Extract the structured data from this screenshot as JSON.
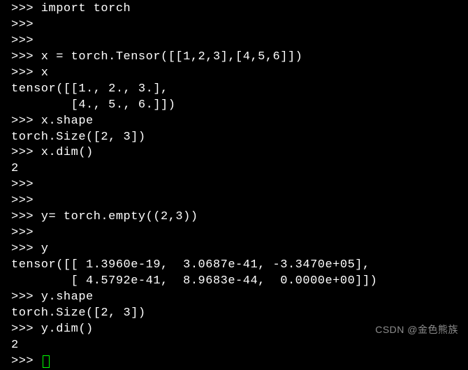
{
  "terminal": {
    "prompt": ">>> ",
    "lines": [
      {
        "text": ">>> import torch"
      },
      {
        "text": ">>>"
      },
      {
        "text": ">>>"
      },
      {
        "text": ">>> x = torch.Tensor([[1,2,3],[4,5,6]])"
      },
      {
        "text": ">>> x"
      },
      {
        "text": "tensor([[1., 2., 3.],"
      },
      {
        "text": "        [4., 5., 6.]])"
      },
      {
        "text": ">>> x.shape"
      },
      {
        "text": "torch.Size([2, 3])"
      },
      {
        "text": ">>> x.dim()"
      },
      {
        "text": "2"
      },
      {
        "text": ">>>"
      },
      {
        "text": ">>>"
      },
      {
        "text": ">>> y= torch.empty((2,3))"
      },
      {
        "text": ">>>"
      },
      {
        "text": ">>> y"
      },
      {
        "text": "tensor([[ 1.3960e-19,  3.0687e-41, -3.3470e+05],"
      },
      {
        "text": "        [ 4.5792e-41,  8.9683e-44,  0.0000e+00]])"
      },
      {
        "text": ">>> y.shape"
      },
      {
        "text": "torch.Size([2, 3])"
      },
      {
        "text": ">>> y.dim()"
      },
      {
        "text": "2"
      },
      {
        "text": ">>> ",
        "cursor": true
      }
    ]
  },
  "watermark": "CSDN @金色熊族"
}
